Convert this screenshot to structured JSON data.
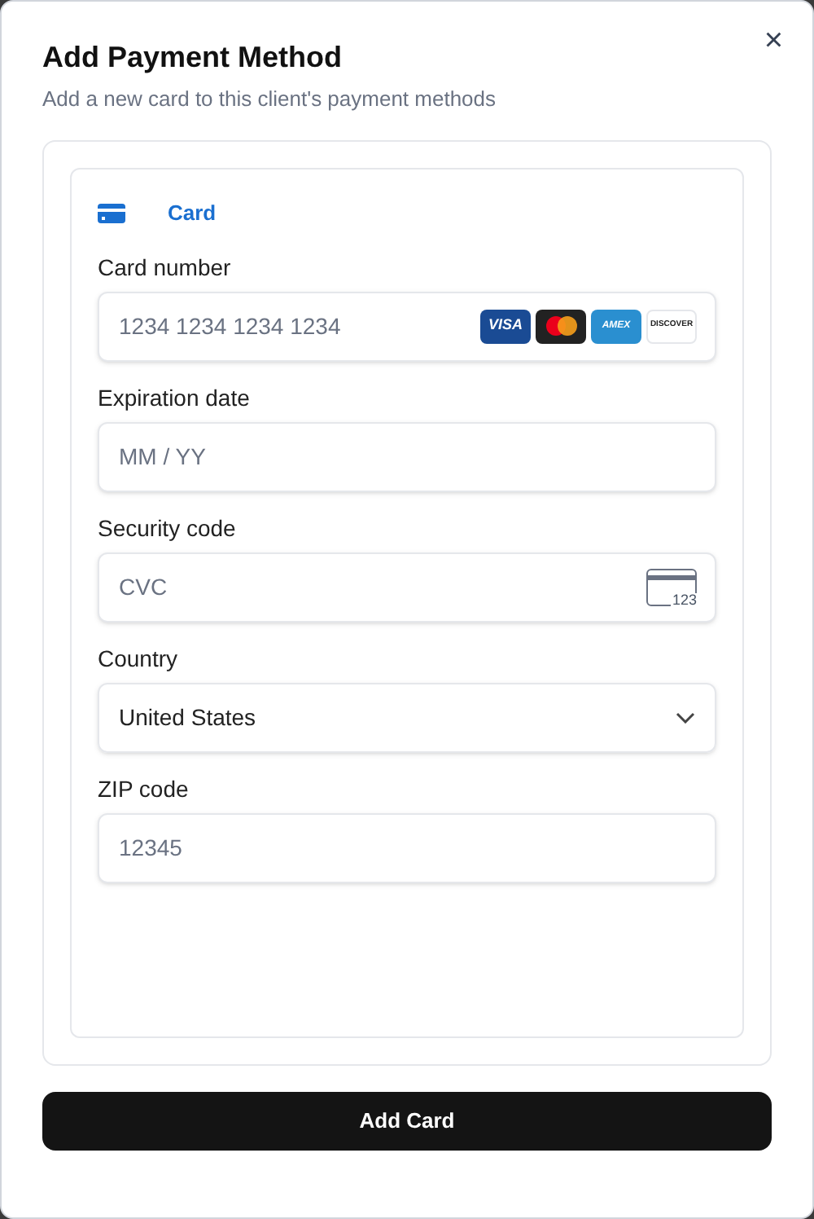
{
  "dialog": {
    "title": "Add Payment Method",
    "subtitle": "Add a new card to this client's payment methods",
    "close": "×"
  },
  "tabs": [
    {
      "label": "Card",
      "selected": true
    }
  ],
  "fields": [
    {
      "kind": "card_number",
      "label": "Card number",
      "placeholder": "1234 1234 1234 1234",
      "brands": [
        {
          "kind": "visa",
          "text": "VISA"
        },
        {
          "kind": "mastercard"
        },
        {
          "kind": "amex",
          "text": "AMEX"
        },
        {
          "kind": "discover",
          "text": "DISCOVER"
        }
      ]
    },
    {
      "kind": "text",
      "label": "Expiration date",
      "placeholder": "MM / YY"
    },
    {
      "kind": "cvc",
      "label": "Security code",
      "placeholder": "CVC",
      "icon_text": "123"
    },
    {
      "kind": "select",
      "label": "Country",
      "value": "United States"
    },
    {
      "kind": "text",
      "label": "ZIP code",
      "placeholder": "12345"
    }
  ],
  "submit": "Add Card"
}
